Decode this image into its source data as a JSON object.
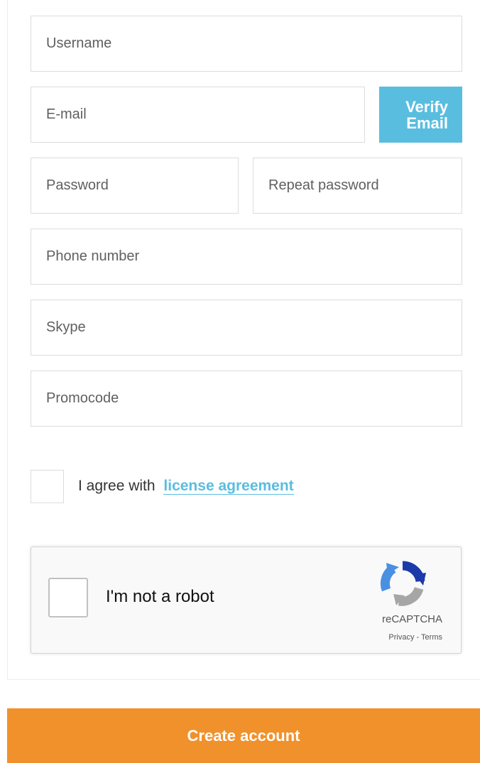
{
  "form": {
    "username": {
      "placeholder": "Username",
      "value": ""
    },
    "email": {
      "placeholder": "E-mail",
      "value": ""
    },
    "verify_email_label": "Verify\nEmail",
    "password": {
      "placeholder": "Password",
      "value": ""
    },
    "repeat_password": {
      "placeholder": "Repeat password",
      "value": ""
    },
    "phone": {
      "placeholder": "Phone number",
      "value": ""
    },
    "skype": {
      "placeholder": "Skype",
      "value": ""
    },
    "promocode": {
      "placeholder": "Promocode",
      "value": ""
    }
  },
  "agreement": {
    "prefix": "I agree with",
    "link_label": "license agreement",
    "checked": false
  },
  "captcha": {
    "label": "I'm not a robot",
    "brand": "reCAPTCHA",
    "privacy": "Privacy",
    "separator": " - ",
    "terms": "Terms",
    "checked": false
  },
  "submit": {
    "label": "Create account"
  },
  "colors": {
    "accent_blue": "#59bde0",
    "submit_orange": "#f1912b",
    "field_border": "#dcdcdc"
  }
}
